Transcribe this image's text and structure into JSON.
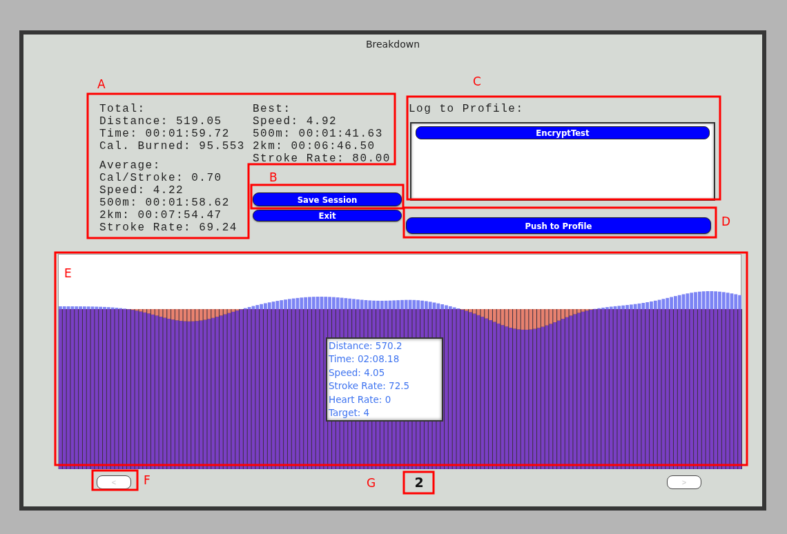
{
  "window": {
    "title": "Breakdown"
  },
  "total": {
    "heading": "Total:",
    "lines": [
      "Distance: 519.05",
      "Time: 00:01:59.72",
      "Cal. Burned: 95.553"
    ]
  },
  "average": {
    "heading": "Average:",
    "lines": [
      "Cal/Stroke: 0.70",
      "Speed: 4.22",
      "500m: 00:01:58.62",
      "2km: 00:07:54.47",
      "Stroke Rate: 69.24"
    ]
  },
  "best": {
    "heading": "Best:",
    "lines": [
      "Speed: 4.92",
      "500m: 00:01:41.63",
      "2km: 00:06:46.50",
      "Stroke Rate: 80.00"
    ]
  },
  "buttons": [
    {
      "label": "Save Session"
    },
    {
      "label": "Exit"
    }
  ],
  "log_to_profile": {
    "label": "Log to Profile:",
    "profiles": [
      {
        "name": "EncryptTest",
        "selected": true
      }
    ],
    "push_button": "Push to Profile"
  },
  "chart": {
    "tooltip": [
      "Distance: 570.2",
      "Time: 02:08.18",
      "Speed: 4.05",
      "Stroke Rate: 72.5",
      "Heart Rate: 0",
      "Target: 4"
    ]
  },
  "pager": {
    "prev": "<",
    "page": "2",
    "next": ">"
  },
  "annotations": [
    {
      "label": "A"
    },
    {
      "label": "B"
    },
    {
      "label": "C"
    },
    {
      "label": "D"
    },
    {
      "label": "E"
    },
    {
      "label": "F"
    },
    {
      "label": "G"
    }
  ]
}
